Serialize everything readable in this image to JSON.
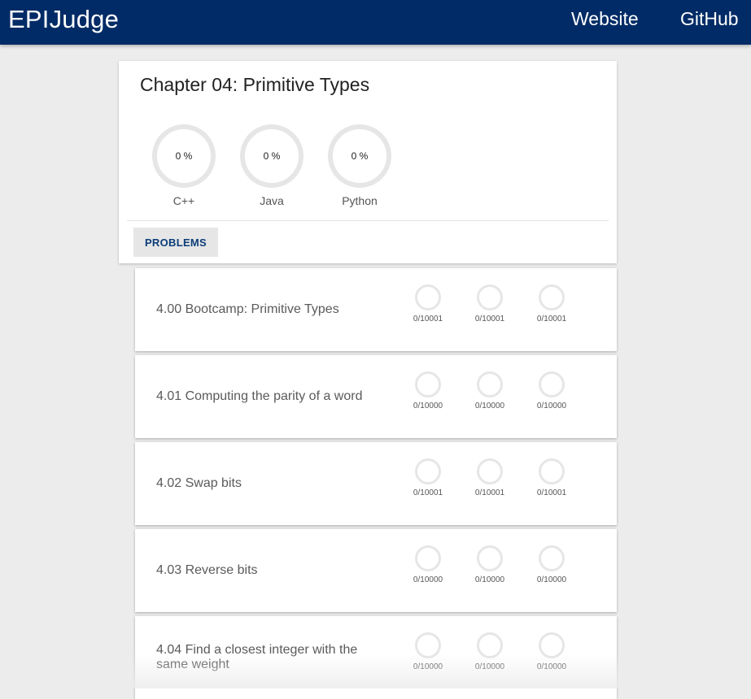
{
  "header": {
    "brand": "EPIJudge",
    "nav": [
      "Website",
      "GitHub"
    ]
  },
  "chapter": {
    "title": "Chapter 04: Primitive Types",
    "languages": [
      {
        "name": "C++",
        "progress_text": "0 %"
      },
      {
        "name": "Java",
        "progress_text": "0 %"
      },
      {
        "name": "Python",
        "progress_text": "0 %"
      }
    ],
    "tab_label": "PROBLEMS"
  },
  "problems": [
    {
      "title": "4.00 Bootcamp: Primitive Types",
      "stats": [
        "0/10001",
        "0/10001",
        "0/10001"
      ]
    },
    {
      "title": "4.01 Computing the parity of a word",
      "stats": [
        "0/10000",
        "0/10000",
        "0/10000"
      ]
    },
    {
      "title": "4.02 Swap bits",
      "stats": [
        "0/10001",
        "0/10001",
        "0/10001"
      ]
    },
    {
      "title": "4.03 Reverse bits",
      "stats": [
        "0/10000",
        "0/10000",
        "0/10000"
      ]
    },
    {
      "title": "4.04 Find a closest integer with the same weight",
      "stats": [
        "0/10000",
        "0/10000",
        "0/10000"
      ]
    }
  ],
  "colors": {
    "header_bg": "#002b66",
    "page_bg": "#ececec",
    "accent": "#0b3d78",
    "ring": "#e6e6e6"
  }
}
